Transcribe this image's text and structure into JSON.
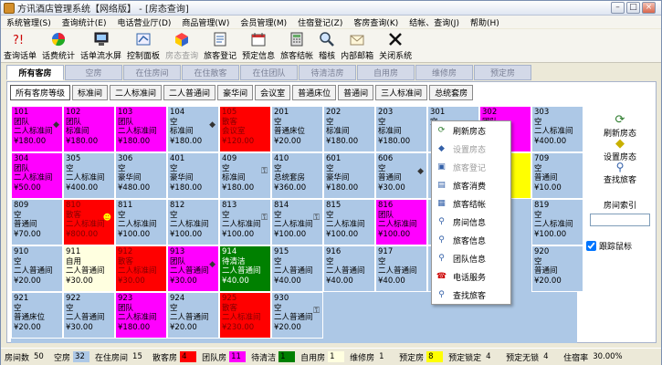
{
  "window": {
    "title": "方讯酒店管理系统【网络版】 - [房态查询]",
    "btn_min": "0",
    "btn_max": "1",
    "btn_close": "r"
  },
  "menu": [
    "系统管理(S)",
    "查询统计(E)",
    "电话营业厅(D)",
    "商品管理(W)",
    "会员管理(M)",
    "住宿登记(Z)",
    "客房查询(K)",
    "结帐、查询(J)",
    "帮助(H)"
  ],
  "toolbar": [
    {
      "label": "查询话单",
      "icon": "query-bill-icon",
      "disabled": false
    },
    {
      "label": "话费统计",
      "icon": "pie-chart-icon",
      "disabled": false
    },
    {
      "label": "话单流水屏",
      "icon": "monitor-icon",
      "disabled": false
    },
    {
      "label": "控制面板",
      "icon": "control-panel-icon",
      "disabled": false
    },
    {
      "label": "房态查询",
      "icon": "cube-icon",
      "disabled": true
    },
    {
      "label": "旅客登记",
      "icon": "register-icon",
      "disabled": false
    },
    {
      "label": "预定信息",
      "icon": "reservation-icon",
      "disabled": false
    },
    {
      "label": "旅客结帐",
      "icon": "checkout-icon",
      "disabled": false
    },
    {
      "label": "稽核",
      "icon": "magnifier-icon",
      "disabled": false
    },
    {
      "label": "内部邮箱",
      "icon": "mail-icon",
      "disabled": false
    },
    {
      "label": "关闭系统",
      "icon": "close-x-icon",
      "disabled": false
    }
  ],
  "status_tabs": [
    "所有客房",
    "空房",
    "在住房间",
    "在住散客",
    "在住团队",
    "待清洁房",
    "自用房",
    "维修房",
    "预定房"
  ],
  "type_tabs": [
    "所有客房等级",
    "标准间",
    "二人标准间",
    "二人普通间",
    "豪华间",
    "会议室",
    "普通床位",
    "普通间",
    "三人标准间",
    "总统套房"
  ],
  "colors": {
    "empty": "#ADC8E6",
    "walkin": "#FF0000",
    "group": "#FF00FF",
    "cleaning": "#008000",
    "self_use": "#FFFFE0",
    "reserved": "#FFFF00"
  },
  "rooms": [
    {
      "no": "101",
      "st": "团队",
      "type": "二人标准间",
      "price": "¥180.00",
      "color": "#FF00FF",
      "fg": "#000",
      "icon": "◆"
    },
    {
      "no": "102",
      "st": "团队",
      "type": "标准间",
      "price": "¥180.00",
      "color": "#FF00FF",
      "fg": "#000"
    },
    {
      "no": "103",
      "st": "团队",
      "type": "二人标准间",
      "price": "¥180.00",
      "color": "#FF00FF",
      "fg": "#000"
    },
    {
      "no": "104",
      "st": "空",
      "type": "标准间",
      "price": "¥180.00",
      "color": "#ADC8E6",
      "fg": "#000",
      "icon": "◆"
    },
    {
      "no": "105",
      "st": "散客",
      "type": "会议室",
      "price": "¥120.00",
      "color": "#FF0000",
      "fg": "#800000"
    },
    {
      "no": "201",
      "st": "空",
      "type": "普通床位",
      "price": "¥20.00",
      "color": "#ADC8E6",
      "fg": "#000"
    },
    {
      "no": "202",
      "st": "空",
      "type": "标准间",
      "price": "¥180.00",
      "color": "#ADC8E6",
      "fg": "#000"
    },
    {
      "no": "203",
      "st": "空",
      "type": "标准间",
      "price": "¥180.00",
      "color": "#ADC8E6",
      "fg": "#000"
    },
    {
      "no": "301",
      "st": "空",
      "type": "",
      "price": "",
      "color": "#ADC8E6",
      "fg": "#000"
    },
    {
      "no": "302",
      "st": "团队",
      "type": "",
      "price": "",
      "color": "#FF00FF",
      "fg": "#000"
    },
    {
      "no": "303",
      "st": "空",
      "type": "二人标准间",
      "price": "¥400.00",
      "color": "#ADC8E6",
      "fg": "#000"
    },
    {
      "no": "304",
      "st": "团队",
      "type": "二人标准间",
      "price": "¥50.00",
      "color": "#FF00FF",
      "fg": "#000"
    },
    {
      "no": "305",
      "st": "空",
      "type": "二人标准间",
      "price": "¥400.00",
      "color": "#ADC8E6",
      "fg": "#000"
    },
    {
      "no": "306",
      "st": "空",
      "type": "豪华间",
      "price": "¥480.00",
      "color": "#ADC8E6",
      "fg": "#000"
    },
    {
      "no": "401",
      "st": "空",
      "type": "豪华间",
      "price": "¥180.00",
      "color": "#ADC8E6",
      "fg": "#000"
    },
    {
      "no": "409",
      "st": "空",
      "type": "标准间",
      "price": "¥180.00",
      "color": "#ADC8E6",
      "fg": "#000",
      "icon": "🔒"
    },
    {
      "no": "410",
      "st": "空",
      "type": "总统套房",
      "price": "¥360.00",
      "color": "#ADC8E6",
      "fg": "#000"
    },
    {
      "no": "601",
      "st": "空",
      "type": "豪华间",
      "price": "¥180.00",
      "color": "#ADC8E6",
      "fg": "#000"
    },
    {
      "no": "606",
      "st": "空",
      "type": "普通间",
      "price": "¥30.00",
      "color": "#ADC8E6",
      "fg": "#000",
      "icon": "◆"
    },
    {
      "no": "",
      "st": "",
      "type": "",
      "price": "",
      "color": "#ADC8E6",
      "fg": "#000"
    },
    {
      "no": "",
      "st": "",
      "type": "",
      "price": "",
      "color": "#FFFF00",
      "fg": "#000"
    },
    {
      "no": "709",
      "st": "空",
      "type": "普通间",
      "price": "¥10.00",
      "color": "#ADC8E6",
      "fg": "#000"
    },
    {
      "no": "809",
      "st": "空",
      "type": "普通间",
      "price": "¥70.00",
      "color": "#ADC8E6",
      "fg": "#000"
    },
    {
      "no": "810",
      "st": "散客",
      "type": "二人标准间",
      "price": "¥800.00",
      "color": "#FF0000",
      "fg": "#800000",
      "icon": "☻"
    },
    {
      "no": "811",
      "st": "空",
      "type": "二人标准间",
      "price": "¥100.00",
      "color": "#ADC8E6",
      "fg": "#000"
    },
    {
      "no": "812",
      "st": "空",
      "type": "二人标准间",
      "price": "¥100.00",
      "color": "#ADC8E6",
      "fg": "#000"
    },
    {
      "no": "813",
      "st": "空",
      "type": "二人标准间",
      "price": "¥100.00",
      "color": "#ADC8E6",
      "fg": "#000",
      "icon": "🔒"
    },
    {
      "no": "814",
      "st": "空",
      "type": "二人标准间",
      "price": "¥100.00",
      "color": "#ADC8E6",
      "fg": "#000",
      "icon": "🔒"
    },
    {
      "no": "815",
      "st": "空",
      "type": "二人标准间",
      "price": "¥100.00",
      "color": "#ADC8E6",
      "fg": "#000"
    },
    {
      "no": "816",
      "st": "团队",
      "type": "二人标准间",
      "price": "¥100.00",
      "color": "#FF00FF",
      "fg": "#000"
    },
    {
      "no": "",
      "st": "",
      "type": "",
      "price": "",
      "color": "#ADC8E6",
      "fg": "#000"
    },
    {
      "no": "819",
      "st": "空",
      "type": "二人标准间",
      "price": "¥100.00",
      "color": "#ADC8E6",
      "fg": "#000"
    },
    {
      "no": "910",
      "st": "空",
      "type": "二人普通间",
      "price": "¥20.00",
      "color": "#ADC8E6",
      "fg": "#000"
    },
    {
      "no": "911",
      "st": "自用",
      "type": "二人普通间",
      "price": "¥30.00",
      "color": "#FFFFE0",
      "fg": "#000"
    },
    {
      "no": "912",
      "st": "散客",
      "type": "二人标准间",
      "price": "¥30.00",
      "color": "#FF0000",
      "fg": "#800000"
    },
    {
      "no": "913",
      "st": "团队",
      "type": "二人普通间",
      "price": "¥30.00",
      "color": "#FF00FF",
      "fg": "#000",
      "icon": "◆"
    },
    {
      "no": "914",
      "st": "待清洁",
      "type": "二人普通间",
      "price": "¥40.00",
      "color": "#008000",
      "fg": "#fff"
    },
    {
      "no": "915",
      "st": "空",
      "type": "二人普通间",
      "price": "¥40.00",
      "color": "#ADC8E6",
      "fg": "#000"
    },
    {
      "no": "916",
      "st": "空",
      "type": "二人普通间",
      "price": "¥40.00",
      "color": "#ADC8E6",
      "fg": "#000"
    },
    {
      "no": "917",
      "st": "空",
      "type": "二人普通间",
      "price": "¥40.00",
      "color": "#ADC8E6",
      "fg": "#000"
    },
    {
      "no": "",
      "st": "",
      "type": "",
      "price": "",
      "color": "#ADC8E6",
      "fg": "#000"
    },
    {
      "no": "920",
      "st": "空",
      "type": "普通间",
      "price": "¥20.00",
      "color": "#ADC8E6",
      "fg": "#000"
    },
    {
      "no": "921",
      "st": "空",
      "type": "普通床位",
      "price": "¥20.00",
      "color": "#ADC8E6",
      "fg": "#000"
    },
    {
      "no": "922",
      "st": "空",
      "type": "二人普通间",
      "price": "¥30.00",
      "color": "#ADC8E6",
      "fg": "#000"
    },
    {
      "no": "923",
      "st": "团队",
      "type": "二人标准间",
      "price": "¥180.00",
      "color": "#FF00FF",
      "fg": "#000"
    },
    {
      "no": "924",
      "st": "空",
      "type": "二人普通间",
      "price": "¥20.00",
      "color": "#ADC8E6",
      "fg": "#000"
    },
    {
      "no": "925",
      "st": "散客",
      "type": "二人标准间",
      "price": "¥230.00",
      "color": "#FF0000",
      "fg": "#800000"
    },
    {
      "no": "930",
      "st": "空",
      "type": "二人普通间",
      "price": "¥20.00",
      "color": "#ADC8E6",
      "fg": "#000",
      "icon": "🔒"
    }
  ],
  "context_menu": [
    {
      "label": "刷新房态",
      "icon": "refresh-icon",
      "glyph": "⟳",
      "disabled": false
    },
    {
      "label": "设置房态",
      "icon": "cube-icon",
      "glyph": "◆",
      "disabled": true
    },
    {
      "label": "旅客登记",
      "icon": "register-icon",
      "glyph": "▣",
      "disabled": true
    },
    {
      "label": "旅客消费",
      "icon": "consume-icon",
      "glyph": "▤",
      "disabled": false
    },
    {
      "label": "旅客结帐",
      "icon": "checkout-icon",
      "glyph": "▦",
      "disabled": false
    },
    {
      "label": "房间信息",
      "icon": "search-icon",
      "glyph": "⚲",
      "disabled": false
    },
    {
      "label": "旅客信息",
      "icon": "search-icon",
      "glyph": "⚲",
      "disabled": false
    },
    {
      "label": "团队信息",
      "icon": "search-icon",
      "glyph": "⚲",
      "disabled": false
    },
    {
      "label": "电话服务",
      "icon": "phone-icon",
      "glyph": "☎",
      "disabled": false
    },
    {
      "label": "查找旅客",
      "icon": "search-icon",
      "glyph": "⚲",
      "disabled": false
    }
  ],
  "side": {
    "refresh": "刷新房态",
    "set_state": "设置房态",
    "find_guest": "查找旅客",
    "room_index": "房间索引",
    "room_index_value": "",
    "follow_mouse": "跟踪鼠标"
  },
  "status": [
    {
      "label": "房间数",
      "value": "50",
      "color": ""
    },
    {
      "label": "空房",
      "value": "32",
      "color": "#ADC8E6"
    },
    {
      "label": "在住房间",
      "value": "15",
      "color": ""
    },
    {
      "label": "散客房",
      "value": "4",
      "color": "#FF0000"
    },
    {
      "label": "团队房",
      "value": "11",
      "color": "#FF00FF"
    },
    {
      "label": "待清洁",
      "value": "1",
      "color": "#008000"
    },
    {
      "label": "自用房",
      "value": "1",
      "color": "#FFFFE0"
    },
    {
      "label": "维修房",
      "value": "1",
      "color": ""
    },
    {
      "label": "预定房",
      "value": "8",
      "color": "#FFFF00"
    },
    {
      "label": "预定锁定",
      "value": "4",
      "color": ""
    },
    {
      "label": "预定无锁",
      "value": "4",
      "color": ""
    },
    {
      "label": "住宿率",
      "value": "30.00%",
      "color": ""
    }
  ]
}
